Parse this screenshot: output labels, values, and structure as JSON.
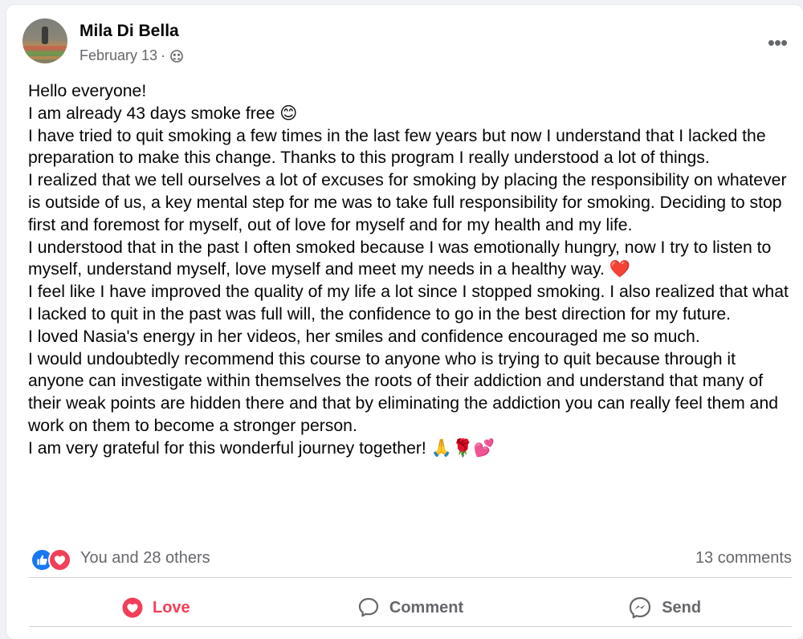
{
  "post": {
    "author": "Mila Di Bella",
    "date": "February 13",
    "separator": "·",
    "paragraphs": [
      "Hello everyone!",
      "I am already 43 days smoke free 😊",
      "I have tried to quit smoking a few times in the last few years but now I understand that I lacked the preparation to make this change.  Thanks to this program I really understood a lot of things.",
      "I realized that we tell ourselves a lot of excuses for smoking by placing the responsibility on whatever is outside of us, a key mental step for me was to take full responsibility for smoking. Deciding to stop first and foremost for myself, out of love for myself and for my health and my life.",
      "I understood that in the past I often smoked because I was emotionally hungry, now I try to listen to myself, understand myself, love myself and meet my needs in a healthy way. ❤️",
      "I feel like I have improved the quality of my life a lot since I stopped smoking. I also realized that what I lacked to quit in the past was full will, the confidence to go in the best direction for my future.",
      "I loved Nasia's energy in her videos, her smiles and confidence encouraged me so much.",
      "I would undoubtedly recommend this course to anyone who is trying to quit because through it anyone can investigate within themselves the roots of their addiction and understand that many of their weak points are hidden there and that by eliminating the addiction you can really feel them and work on them to become a stronger person.",
      "I am very grateful for this wonderful journey together! 🙏🌹💕"
    ]
  },
  "stats": {
    "reactions_text": "You and 28 others",
    "comments_text": "13 comments"
  },
  "actions": {
    "love_label": "Love",
    "comment_label": "Comment",
    "send_label": "Send"
  },
  "colors": {
    "like_blue": "#1877f2",
    "love_red": "#f33e58",
    "secondary_text": "#65676b"
  }
}
